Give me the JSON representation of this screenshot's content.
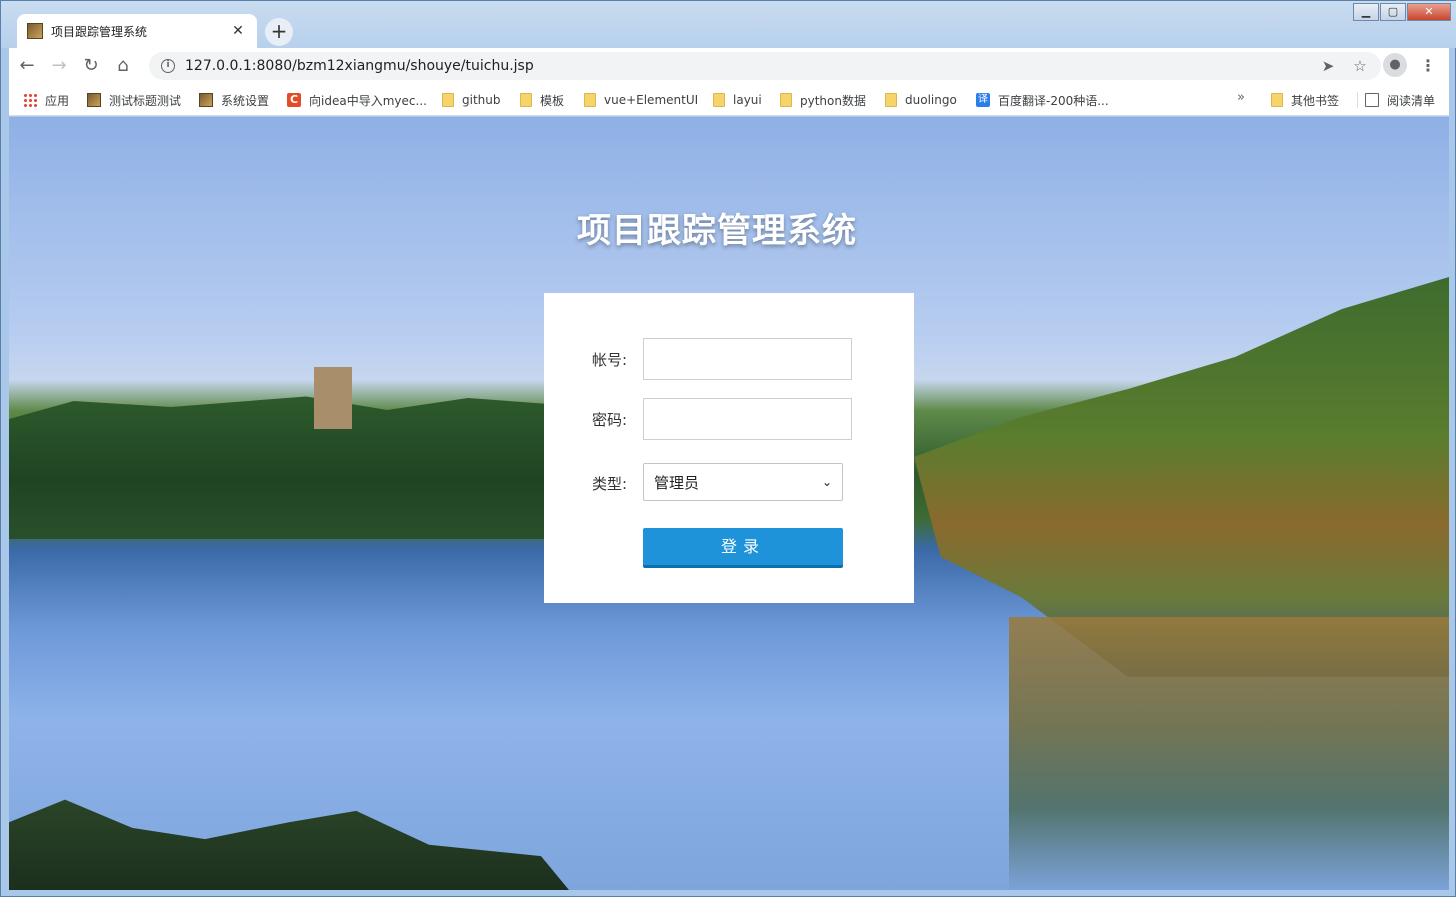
{
  "browser": {
    "tab_title": "项目跟踪管理系统",
    "tab_close": "✕",
    "new_tab": "+",
    "url": "127.0.0.1:8080/bzm12xiangmu/shouye/tuichu.jsp",
    "window_buttons": {
      "minimize": "▁",
      "maximize": "▢",
      "close": "✕"
    },
    "nav": {
      "back": "←",
      "forward": "→",
      "reload": "↻",
      "home": "⌂"
    },
    "omnibox_icons": {
      "info": "i",
      "send": "➤",
      "star": "☆"
    },
    "profile": "●",
    "menu": "⋮"
  },
  "bookmarks": {
    "items": [
      {
        "label": "应用",
        "icon": "apps-icon"
      },
      {
        "label": "测试标题测试",
        "icon": "image-icon"
      },
      {
        "label": "系统设置",
        "icon": "image-icon"
      },
      {
        "label": "向idea中导入myec...",
        "icon": "c-icon"
      },
      {
        "label": "github",
        "icon": "folder-icon"
      },
      {
        "label": "模板",
        "icon": "folder-icon"
      },
      {
        "label": "vue+ElementUI",
        "icon": "folder-icon"
      },
      {
        "label": "layui",
        "icon": "folder-icon"
      },
      {
        "label": "python数据",
        "icon": "folder-icon"
      },
      {
        "label": "duolingo",
        "icon": "folder-icon"
      },
      {
        "label": "百度翻译-200种语...",
        "icon": "translate-icon"
      }
    ],
    "overflow": "»",
    "other": "其他书签",
    "reading_list": "阅读清单",
    "c_glyph": "C",
    "translate_glyph": "译"
  },
  "page": {
    "title": "项目跟踪管理系统",
    "form": {
      "account_label": "帐号:",
      "account_value": "",
      "password_label": "密码:",
      "password_value": "",
      "type_label": "类型:",
      "type_selected": "管理员",
      "type_chevron": "⌄",
      "submit_label": "登录"
    }
  }
}
